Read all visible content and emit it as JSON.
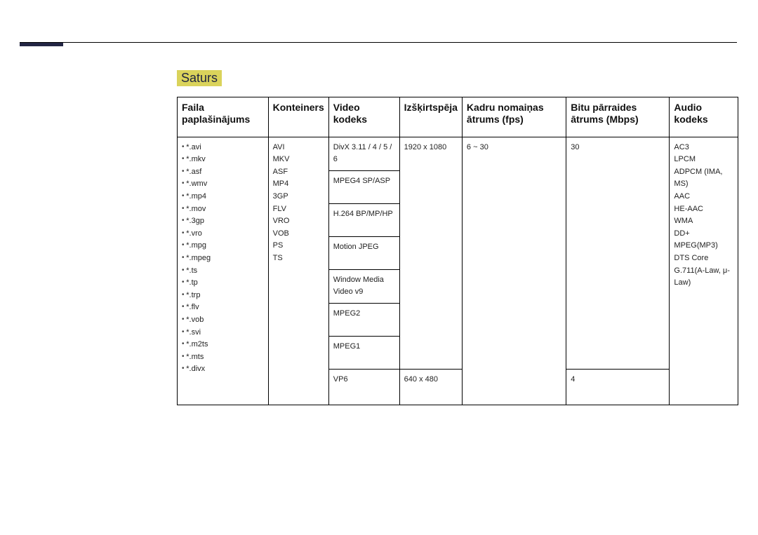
{
  "heading": "Saturs",
  "headers": {
    "file_ext": "Faila paplašinājums",
    "container": "Konteiners",
    "video_codec": "Video kodeks",
    "resolution": "Izšķirtspēja",
    "fps": "Kadru nomaiņas ātrums (fps)",
    "bitrate": "Bitu pārraides ātrums (Mbps)",
    "audio_codec": "Audio kodeks"
  },
  "file_extensions": [
    "*.avi",
    "*.mkv",
    "*.asf",
    "*.wmv",
    "*.mp4",
    "*.mov",
    "*.3gp",
    "*.vro",
    "*.mpg",
    "*.mpeg",
    "*.ts",
    "*.tp",
    "*.trp",
    "*.flv",
    "*.vob",
    "*.svi",
    "*.m2ts",
    "*.mts",
    "*.divx"
  ],
  "containers": [
    "AVI",
    "MKV",
    "ASF",
    "MP4",
    "3GP",
    "FLV",
    "VRO",
    "VOB",
    "PS",
    "TS"
  ],
  "video_rows": [
    {
      "codec": "DivX 3.11 / 4 / 5 / 6",
      "res": "1920 x 1080",
      "fps": "6 ~ 30",
      "bitrate": "30"
    },
    {
      "codec": "MPEG4 SP/ASP",
      "res": "",
      "fps": "",
      "bitrate": ""
    },
    {
      "codec": "H.264 BP/MP/HP",
      "res": "",
      "fps": "",
      "bitrate": ""
    },
    {
      "codec": "Motion JPEG",
      "res": "",
      "fps": "",
      "bitrate": ""
    },
    {
      "codec": "Window Media Video v9",
      "res": "",
      "fps": "",
      "bitrate": ""
    },
    {
      "codec": "MPEG2",
      "res": "",
      "fps": "",
      "bitrate": ""
    },
    {
      "codec": "MPEG1",
      "res": "",
      "fps": "",
      "bitrate": ""
    },
    {
      "codec": "VP6",
      "res": "640 x 480",
      "fps": "",
      "bitrate": "4"
    }
  ],
  "audio_codecs": [
    "AC3",
    "LPCM",
    "ADPCM (IMA, MS)",
    "AAC",
    "HE-AAC",
    "WMA",
    "DD+",
    "MPEG(MP3)",
    "DTS Core",
    "G.711(A-Law, μ-Law)"
  ]
}
